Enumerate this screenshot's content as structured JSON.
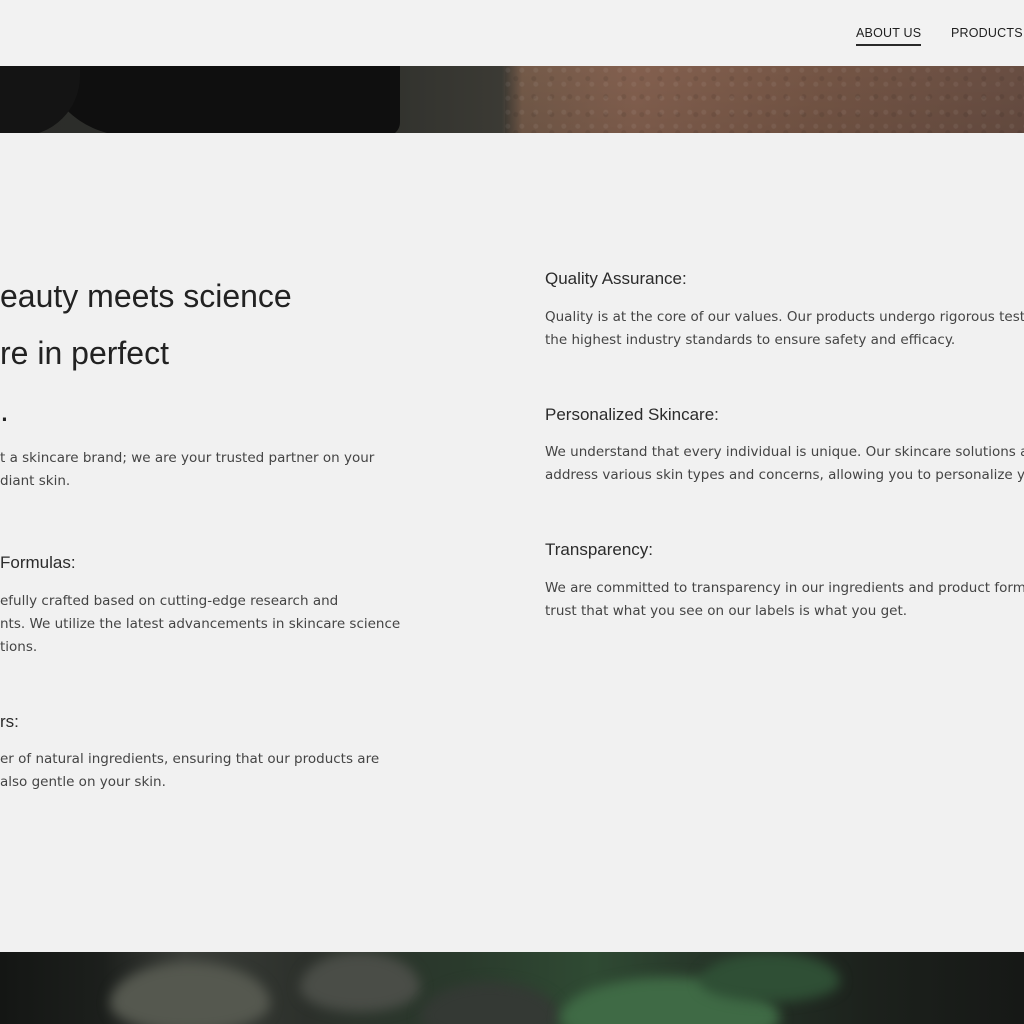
{
  "nav": {
    "items": [
      {
        "label": "ABOUT US",
        "active": true
      },
      {
        "label": "PRODUCTS",
        "active": false
      }
    ]
  },
  "headline": {
    "lines": [
      "eauty meets science",
      "re in perfect",
      "."
    ]
  },
  "intro": {
    "lines": [
      "t a skincare brand; we are your trusted partner on your",
      "diant skin."
    ]
  },
  "left_sections": [
    {
      "title": "Formulas:",
      "lines": [
        "efully crafted based on cutting-edge research and",
        "nts. We utilize the latest advancements in skincare science",
        "tions."
      ]
    },
    {
      "title": "rs:",
      "lines": [
        "er of natural ingredients, ensuring that our products are",
        "also gentle on your skin."
      ]
    }
  ],
  "right_sections": [
    {
      "title": "Quality Assurance:",
      "lines": [
        "Quality is at the core of our values. Our products undergo rigorous testin",
        "the highest industry standards to ensure safety and efficacy."
      ]
    },
    {
      "title": "Personalized Skincare:",
      "lines": [
        "We understand that every individual is unique. Our skincare solutions ar",
        "address various skin types and concerns, allowing you to personalize yo"
      ]
    },
    {
      "title": "Transparency:",
      "lines": [
        "We are committed to transparency in our ingredients and product formu",
        "trust that what you see on our labels is what you get."
      ]
    }
  ],
  "colors": {
    "background": "#f1f1f1",
    "text": "#3a3a3a",
    "heading": "#222222"
  }
}
